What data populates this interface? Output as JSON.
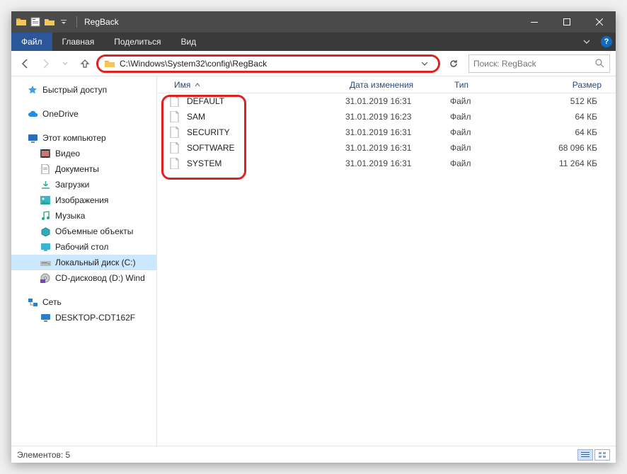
{
  "titlebar": {
    "title": "RegBack"
  },
  "menu": {
    "file": "Файл",
    "home": "Главная",
    "share": "Поделиться",
    "view": "Вид"
  },
  "address": {
    "path": "C:\\Windows\\System32\\config\\RegBack"
  },
  "search": {
    "placeholder": "Поиск: RegBack"
  },
  "sidebar": {
    "quick_access": "Быстрый доступ",
    "onedrive": "OneDrive",
    "this_pc": "Этот компьютер",
    "videos": "Видео",
    "documents": "Документы",
    "downloads": "Загрузки",
    "pictures": "Изображения",
    "music": "Музыка",
    "objects3d": "Объемные объекты",
    "desktop": "Рабочий стол",
    "local_disk": "Локальный диск (C:)",
    "cd_drive": "CD-дисковод (D:) Wind",
    "network": "Сеть",
    "network_pc": "DESKTOP-CDT162F"
  },
  "columns": {
    "name": "Имя",
    "date": "Дата изменения",
    "type": "Тип",
    "size": "Размер"
  },
  "files": [
    {
      "name": "DEFAULT",
      "date": "31.01.2019 16:31",
      "type": "Файл",
      "size": "512 КБ"
    },
    {
      "name": "SAM",
      "date": "31.01.2019 16:23",
      "type": "Файл",
      "size": "64 КБ"
    },
    {
      "name": "SECURITY",
      "date": "31.01.2019 16:31",
      "type": "Файл",
      "size": "64 КБ"
    },
    {
      "name": "SOFTWARE",
      "date": "31.01.2019 16:31",
      "type": "Файл",
      "size": "68 096 КБ"
    },
    {
      "name": "SYSTEM",
      "date": "31.01.2019 16:31",
      "type": "Файл",
      "size": "11 264 КБ"
    }
  ],
  "status": {
    "count_label": "Элементов: 5"
  }
}
